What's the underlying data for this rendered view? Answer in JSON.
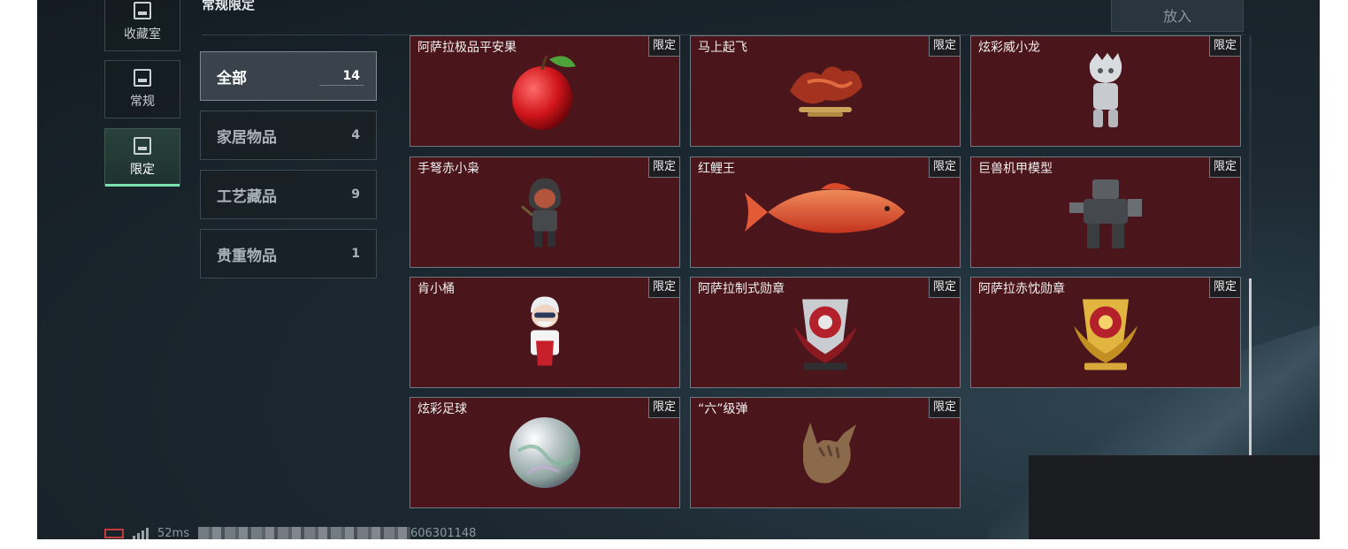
{
  "nav": {
    "items": [
      {
        "label": "收藏室",
        "icon": "collection-room-icon",
        "active": false
      },
      {
        "label": "常规",
        "icon": "regular-icon",
        "active": false
      },
      {
        "label": "限定",
        "icon": "limited-icon",
        "active": true
      }
    ]
  },
  "header": {
    "title": "常规限定",
    "put_in_label": "放入"
  },
  "categories": [
    {
      "label": "全部",
      "count": "14",
      "active": true
    },
    {
      "label": "家居物品",
      "count": "4",
      "active": false
    },
    {
      "label": "工艺藏品",
      "count": "9",
      "active": false
    },
    {
      "label": "贵重物品",
      "count": "1",
      "active": false
    }
  ],
  "items": [
    {
      "name": "阿萨拉极品平安果",
      "badge": "限定",
      "icon": "apple-icon"
    },
    {
      "name": "马上起飞",
      "badge": "限定",
      "icon": "flying-horse-icon"
    },
    {
      "name": "炫彩威小龙",
      "badge": "限定",
      "icon": "silver-figure-icon"
    },
    {
      "name": "手弩赤小枭",
      "badge": "限定",
      "icon": "hooded-figure-icon"
    },
    {
      "name": "红鲤王",
      "badge": "限定",
      "icon": "red-carp-icon"
    },
    {
      "name": "巨兽机甲模型",
      "badge": "限定",
      "icon": "mech-model-icon"
    },
    {
      "name": "肯小桶",
      "badge": "限定",
      "icon": "colonel-figure-icon"
    },
    {
      "name": "阿萨拉制式勋章",
      "badge": "限定",
      "icon": "silver-medal-icon"
    },
    {
      "name": "阿萨拉赤忱勋章",
      "badge": "限定",
      "icon": "gold-medal-icon"
    },
    {
      "name": "炫彩足球",
      "badge": "限定",
      "icon": "iridescent-ball-icon"
    },
    {
      "name": "“六”级弹",
      "badge": "限定",
      "icon": "hand-gesture-icon"
    }
  ],
  "status": {
    "ping": "52ms",
    "uid": "606301148"
  },
  "colors": {
    "card_background": "#4a161b",
    "active_accent": "#7ce3b0",
    "battery": "#c43b3b"
  }
}
